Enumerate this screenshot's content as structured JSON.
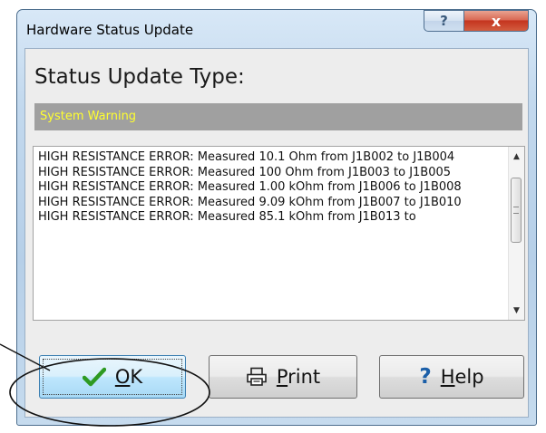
{
  "window": {
    "title": "Hardware Status Update",
    "help_glyph": "?",
    "close_glyph": "x"
  },
  "status": {
    "heading": "Status Update Type:",
    "type_value": "System Warning",
    "type_bg_color": "#a0a0a0",
    "type_text_color": "#ffff2e"
  },
  "log": {
    "lines": [
      "HIGH RESISTANCE ERROR: Measured 10.1 Ohm from J1B002 to J1B004",
      "HIGH RESISTANCE ERROR: Measured 100 Ohm from J1B003 to J1B005",
      "HIGH RESISTANCE ERROR: Measured 1.00 kOhm from J1B006 to J1B008",
      "HIGH RESISTANCE ERROR: Measured 9.09 kOhm from J1B007 to J1B010",
      "HIGH RESISTANCE ERROR: Measured 85.1 kOhm from J1B013 to"
    ]
  },
  "buttons": {
    "ok": {
      "label": "OK",
      "mnemonic": "O",
      "rest": "K",
      "icon": "checkmark-icon"
    },
    "print": {
      "label": "Print",
      "mnemonic": "P",
      "rest": "rint",
      "icon": "printer-icon"
    },
    "help": {
      "label": "Help",
      "mnemonic": "H",
      "rest": "elp",
      "icon": "question-icon"
    }
  },
  "colors": {
    "ok_check": "#2e9a22",
    "help_question": "#1b5fa8"
  }
}
